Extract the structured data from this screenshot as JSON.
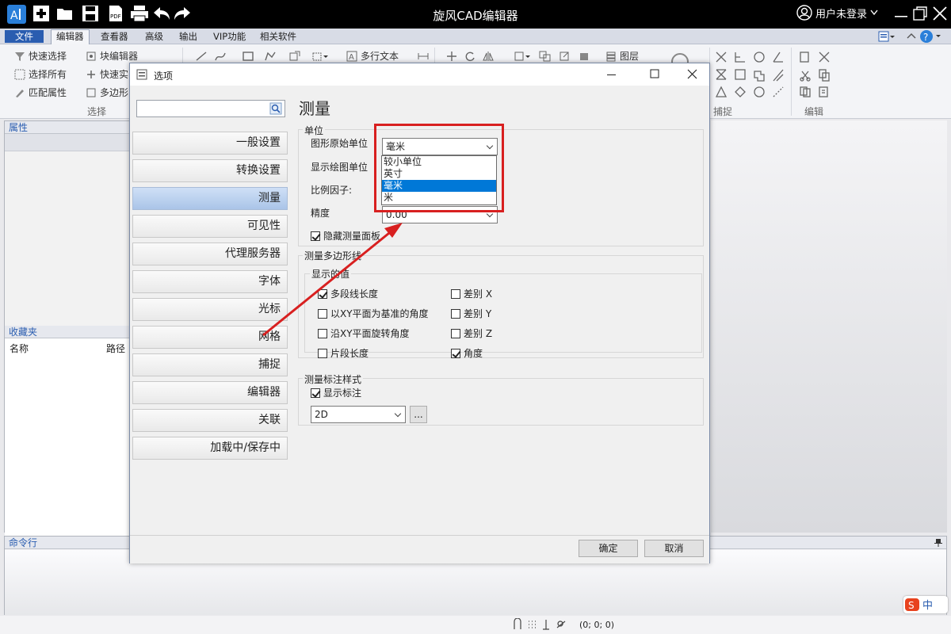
{
  "window": {
    "title": "旋风CAD编辑器",
    "user": "用户未登录"
  },
  "menu": [
    "文件",
    "编辑器",
    "查看器",
    "高级",
    "输出",
    "VIP功能",
    "相关软件"
  ],
  "ribbon": {
    "select_group": {
      "label": "选择",
      "items": [
        "快速选择",
        "选择所有",
        "匹配属性"
      ]
    },
    "block_items": [
      "块编辑器",
      "快速实",
      "多边形"
    ],
    "text_item": "多行文本",
    "layer_item": "图层",
    "snap_group_label": "捕捉",
    "edit_group_label": "编辑"
  },
  "panels": {
    "properties": "属性",
    "favorites": "收藏夹",
    "fav_columns": [
      "名称",
      "路径"
    ],
    "command_line": "命令行"
  },
  "status": {
    "coords": "(0; 0; 0)"
  },
  "dialog": {
    "title": "选项",
    "search_placeholder": "",
    "categories": [
      "一般设置",
      "转换设置",
      "测量",
      "可见性",
      "代理服务器",
      "字体",
      "光标",
      "网格",
      "捕捉",
      "编辑器",
      "关联",
      "加载中/保存中"
    ],
    "selected_category": "测量",
    "content_title": "测量",
    "units": {
      "legend": "单位",
      "original_unit_label": "图形原始单位",
      "original_unit_value": "毫米",
      "display_unit_label": "显示绘图单位",
      "scale_label": "比例因子:",
      "precision_label": "精度",
      "precision_value": "0.00",
      "hide_panel_label": "隐藏测量面板",
      "dropdown_options": [
        "较小单位",
        "英寸",
        "毫米",
        "米"
      ],
      "highlighted_option": "毫米"
    },
    "polygon": {
      "legend": "测量多边形线",
      "sub_legend": "显示的值",
      "left": [
        {
          "label": "多段线长度",
          "checked": true
        },
        {
          "label": "以XY平面为基准的角度",
          "checked": false
        },
        {
          "label": "沿XY平面旋转角度",
          "checked": false
        },
        {
          "label": "片段长度",
          "checked": false
        }
      ],
      "right": [
        {
          "label": "差别 X",
          "checked": false
        },
        {
          "label": "差别 Y",
          "checked": false
        },
        {
          "label": "差别 Z",
          "checked": false
        },
        {
          "label": "角度",
          "checked": true
        }
      ]
    },
    "annotation": {
      "legend": "测量标注样式",
      "show_label": "显示标注",
      "style_value": "2D",
      "more_button": "..."
    },
    "ok": "确定",
    "cancel": "取消"
  },
  "colors": {
    "accent": "#2a5db0",
    "highlight_frame": "#d82020",
    "arrow": "#d82020",
    "selection": "#0078d7"
  }
}
